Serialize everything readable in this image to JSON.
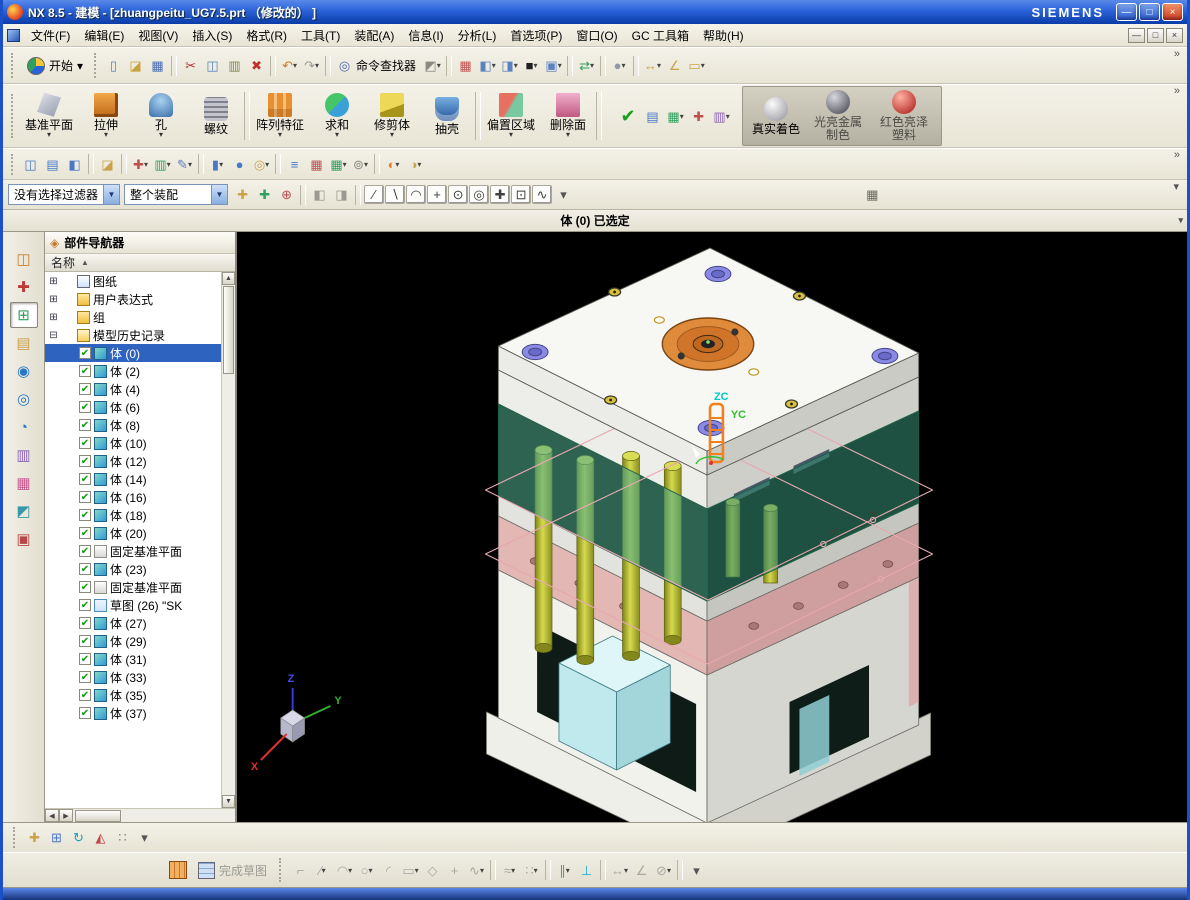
{
  "colors": {
    "titlebar": "#2a62d8",
    "selection": "#2f63c0",
    "viewport_bg": "#000000",
    "check_green": "#0c9a0c"
  },
  "chrome": {
    "overflow": "»",
    "more": "▾",
    "up": "▲",
    "down": "▼",
    "left": "◀",
    "right": "▶"
  },
  "window": {
    "title": "NX 8.5 - 建模 - [zhuangpeitu_UG7.5.prt （修改的） ]",
    "brand": "SIEMENS",
    "minimize": "—",
    "restore": "□",
    "close": "×"
  },
  "menu": {
    "items": [
      {
        "name": "menu-file",
        "label": "文件(F)"
      },
      {
        "name": "menu-edit",
        "label": "编辑(E)"
      },
      {
        "name": "menu-view",
        "label": "视图(V)"
      },
      {
        "name": "menu-insert",
        "label": "插入(S)"
      },
      {
        "name": "menu-format",
        "label": "格式(R)"
      },
      {
        "name": "menu-tools",
        "label": "工具(T)"
      },
      {
        "name": "menu-assemblies",
        "label": "装配(A)"
      },
      {
        "name": "menu-information",
        "label": "信息(I)"
      },
      {
        "name": "menu-analysis",
        "label": "分析(L)"
      },
      {
        "name": "menu-preferences",
        "label": "首选项(P)"
      },
      {
        "name": "menu-window",
        "label": "窗口(O)"
      },
      {
        "name": "menu-gc-toolbox",
        "label": "GC 工具箱"
      },
      {
        "name": "menu-help",
        "label": "帮助(H)"
      }
    ]
  },
  "toolbar1": {
    "start_label": "开始",
    "start_dd": "▾",
    "finder_label": "命令查找器",
    "icons_a": [
      {
        "name": "new-part-icon",
        "g": "▯",
        "c": "#5a82c0"
      },
      {
        "name": "open-icon",
        "g": "◪",
        "c": "#c8a23a"
      },
      {
        "name": "save-icon",
        "g": "▦",
        "c": "#4668b0"
      },
      {
        "cls": "sep",
        "inter": "false"
      },
      {
        "name": "cut-icon",
        "g": "✂",
        "c": "#b03030"
      },
      {
        "name": "copy-icon",
        "g": "◫",
        "c": "#5a82c0"
      },
      {
        "name": "paste-icon",
        "g": "▥",
        "c": "#7a8a50"
      },
      {
        "name": "delete-icon",
        "g": "✖",
        "c": "#c03030"
      },
      {
        "cls": "sep",
        "inter": "false"
      },
      {
        "name": "undo-icon",
        "g": "↶",
        "c": "#d07820",
        "dd": "▾"
      },
      {
        "name": "redo-icon",
        "g": "↷",
        "c": "#9a9a92",
        "dd": "▾"
      },
      {
        "cls": "sep",
        "inter": "false"
      },
      {
        "name": "command-finder-icon",
        "g": "◎",
        "c": "#4668b0"
      }
    ],
    "icons_b": [
      {
        "name": "touch-mode-icon",
        "g": "◩",
        "c": "#8a8a82",
        "dd": "▾"
      },
      {
        "cls": "sep",
        "inter": "false"
      },
      {
        "name": "window-grid-icon",
        "g": "▦",
        "c": "#c05050"
      },
      {
        "name": "cascade-windows-icon",
        "g": "◧",
        "c": "#5a82c0",
        "dd": "▾"
      },
      {
        "name": "display-cube-icon",
        "g": "◨",
        "c": "#5a82c0",
        "dd": "▾"
      },
      {
        "name": "black-screen-icon",
        "g": "■",
        "c": "#202020",
        "dd": "▾"
      },
      {
        "name": "tile-windows-icon",
        "g": "▣",
        "c": "#5a82c0",
        "dd": "▾"
      },
      {
        "cls": "sep",
        "inter": "false"
      },
      {
        "name": "swap-views-icon",
        "g": "⇄",
        "c": "#30a060",
        "dd": "▾"
      },
      {
        "cls": "sep",
        "inter": "false"
      },
      {
        "name": "material-sphere-icon",
        "g": "●",
        "c": "#9098a8",
        "dd": "▾"
      },
      {
        "cls": "sep",
        "inter": "false"
      },
      {
        "name": "measure-distance-icon",
        "g": "↔",
        "c": "#caa24a",
        "dd": "▾"
      },
      {
        "name": "measure-angle-icon",
        "g": "∠",
        "c": "#caa24a"
      },
      {
        "name": "ruler-icon",
        "g": "▭",
        "c": "#caa24a",
        "dd": "▾"
      }
    ]
  },
  "toolbar2": {
    "items": [
      {
        "name": "datum-plane-button",
        "label": "基准平面",
        "icon": "fi-datum",
        "dd": "▾"
      },
      {
        "name": "extrude-button",
        "label": "拉伸",
        "icon": "fi-extrude",
        "dd": "▾"
      },
      {
        "name": "hole-button",
        "label": "孔",
        "icon": "fi-hole",
        "dd": "▾"
      },
      {
        "name": "thread-button",
        "label": "螺纹",
        "icon": "fi-thread",
        "dd": ""
      },
      {
        "cls": "fsep",
        "inter": "false"
      },
      {
        "name": "pattern-feature-button",
        "label": "阵列特征",
        "icon": "fi-pattern",
        "dd": "▾"
      },
      {
        "name": "unite-button",
        "label": "求和",
        "icon": "fi-unite",
        "dd": "▾"
      },
      {
        "name": "trim-body-button",
        "label": "修剪体",
        "icon": "fi-trim",
        "dd": "▾"
      },
      {
        "name": "shell-button",
        "label": "抽壳",
        "icon": "fi-shell",
        "dd": ""
      },
      {
        "cls": "fsep",
        "inter": "false"
      },
      {
        "name": "offset-region-button",
        "label": "偏置区域",
        "icon": "fi-offset",
        "dd": "▾"
      },
      {
        "name": "delete-face-button",
        "label": "删除面",
        "icon": "fi-delface",
        "dd": "▾"
      },
      {
        "cls": "fsep",
        "inter": "false"
      }
    ],
    "check_cluster": [
      {
        "name": "approve-check-icon",
        "g": "✔",
        "c": "#18a018",
        "cls": "big"
      },
      {
        "name": "mini-table-icon",
        "g": "▤",
        "c": "#4a78c8"
      },
      {
        "name": "mini-grid-icon",
        "g": "▦",
        "c": "#30a060",
        "dd": "▾"
      },
      {
        "name": "mini-axis-icon",
        "g": "✚",
        "c": "#c05050"
      },
      {
        "name": "mini-sheet-icon",
        "g": "▥",
        "c": "#8a62b8",
        "dd": "▾"
      }
    ],
    "shading": [
      {
        "name": "true-shading-button",
        "label": "真实着色",
        "icon": "fi-sph-gray",
        "dd": ""
      },
      {
        "name": "shiny-metal-shading-button",
        "label": "光亮金属制色",
        "icon": "fi-sph-dark",
        "dd": "",
        "cls": "dim wrap"
      },
      {
        "name": "red-plastic-shading-button",
        "label": "红色亮泽塑料",
        "icon": "fi-sph-red",
        "dd": "",
        "cls": "dim wrap"
      }
    ]
  },
  "toolbar3": {
    "icons": [
      {
        "name": "edit-section-icon",
        "g": "◫",
        "c": "#4a78c8"
      },
      {
        "name": "layer-settings-icon",
        "g": "▤",
        "c": "#4a78c8"
      },
      {
        "name": "view-section-icon",
        "g": "◧",
        "c": "#4a78c8"
      },
      {
        "cls": "sep",
        "inter": "false"
      },
      {
        "name": "open-book-icon",
        "g": "◪",
        "c": "#caa24a"
      },
      {
        "cls": "sep",
        "inter": "false"
      },
      {
        "name": "pmi-icon",
        "g": "✚",
        "c": "#c05050",
        "dd": "▾"
      },
      {
        "name": "annotation-icon",
        "g": "▥",
        "c": "#30a060",
        "dd": "▾"
      },
      {
        "name": "sketch-curve-icon",
        "g": "✎",
        "c": "#6078b8",
        "dd": "▾"
      },
      {
        "cls": "sep",
        "inter": "false"
      },
      {
        "name": "cylinder-icon",
        "g": "▮",
        "c": "#4a78c8",
        "dd": "▾"
      },
      {
        "name": "sphere-icon",
        "g": "●",
        "c": "#4a78c8"
      },
      {
        "name": "torus-icon",
        "g": "◎",
        "c": "#caa24a",
        "dd": "▾"
      },
      {
        "cls": "sep",
        "inter": "false"
      },
      {
        "name": "list-view-icon",
        "g": "≡",
        "c": "#4a78c8"
      },
      {
        "name": "table-red-icon",
        "g": "▦",
        "c": "#c05050"
      },
      {
        "name": "table-green-icon",
        "g": "▦",
        "c": "#30a060",
        "dd": "▾"
      },
      {
        "name": "gear-icon",
        "g": "⊚",
        "c": "#888880",
        "dd": "▾"
      },
      {
        "cls": "sep",
        "inter": "false"
      },
      {
        "name": "pair-orange-icon",
        "g": "◐",
        "c": "#e08030",
        "dd": "▾"
      },
      {
        "name": "pair-yellow-icon",
        "g": "◑",
        "c": "#caa24a",
        "dd": "▾"
      }
    ]
  },
  "selbar": {
    "filter_value": "没有选择过滤器",
    "scope_value": "整个装配",
    "dd": "▼",
    "icons": [
      {
        "name": "select-all-icon",
        "g": "✚",
        "c": "#caa24a"
      },
      {
        "name": "select-highlight-icon",
        "g": "✚",
        "c": "#30a060"
      },
      {
        "name": "select-previous-icon",
        "g": "⊕",
        "c": "#c05050"
      },
      {
        "cls": "sep",
        "inter": "false"
      },
      {
        "name": "gray-cube-a-icon",
        "g": "◧",
        "c": "#9a9a92"
      },
      {
        "name": "gray-cube-b-icon",
        "g": "◨",
        "c": "#9a9a92"
      },
      {
        "cls": "sep",
        "inter": "false"
      },
      {
        "name": "snap-endpoint-icon",
        "g": "∕",
        "c": "#404040",
        "cls": "tog"
      },
      {
        "name": "snap-midpoint-icon",
        "g": "∖",
        "c": "#404040",
        "cls": "tog"
      },
      {
        "name": "snap-arc-icon",
        "g": "◠",
        "c": "#404040",
        "cls": "tog"
      },
      {
        "name": "snap-point-icon",
        "g": "+",
        "c": "#404040",
        "cls": "tog"
      },
      {
        "name": "snap-center-icon",
        "g": "⊙",
        "c": "#404040",
        "cls": "tog"
      },
      {
        "name": "snap-quadrant-icon",
        "g": "◎",
        "c": "#404040",
        "cls": "tog"
      },
      {
        "name": "snap-intersection-icon",
        "g": "✚",
        "c": "#404040",
        "cls": "tog"
      },
      {
        "name": "snap-face-icon",
        "g": "⊡",
        "c": "#404040",
        "cls": "tog"
      },
      {
        "name": "snap-curve-icon",
        "g": "∿",
        "c": "#404040",
        "cls": "tog"
      },
      {
        "name": "snap-options-arrow",
        "g": "▾",
        "c": "#555"
      }
    ],
    "grid_glyph": "▦"
  },
  "prompt": {
    "text": "体 (0) 已选定"
  },
  "resource": {
    "icons": [
      {
        "name": "assembly-navigator-icon",
        "g": "◫",
        "c": "#d08030"
      },
      {
        "name": "constraint-navigator-icon",
        "g": "✚",
        "c": "#c03838"
      },
      {
        "name": "part-navigator-icon",
        "g": "⊞",
        "c": "#2e9e5e",
        "cls": "active"
      },
      {
        "name": "reuse-library-icon",
        "g": "▤",
        "c": "#caa24a"
      },
      {
        "name": "hd3d-tool-icon",
        "g": "◉",
        "c": "#2878c8"
      },
      {
        "name": "web-browser-icon",
        "g": "◎",
        "c": "#2878c8"
      },
      {
        "name": "history-icon",
        "g": "◔",
        "c": "#2878c8"
      },
      {
        "name": "process-studio-icon",
        "g": "▥",
        "c": "#8a62b8"
      },
      {
        "name": "manufacturing-wizards-icon",
        "g": "▦",
        "c": "#c85890"
      },
      {
        "name": "roles-icon",
        "g": "◩",
        "c": "#3898a8"
      },
      {
        "name": "system-materials-icon",
        "g": "▣",
        "c": "#b84848"
      }
    ]
  },
  "navigator": {
    "title": "部件导航器",
    "column": "名称",
    "sort": "▲",
    "items": [
      {
        "name": "tree-item-drawing",
        "label": "图纸",
        "exp": "⊞",
        "chk": "",
        "icon": "i-draw",
        "cls": ""
      },
      {
        "name": "tree-item-user-expressions",
        "label": "用户表达式",
        "exp": "⊞",
        "chk": "",
        "icon": "i-folder",
        "cls": ""
      },
      {
        "name": "tree-item-group",
        "label": "组",
        "exp": "⊞",
        "chk": "",
        "icon": "i-folder",
        "cls": ""
      },
      {
        "name": "tree-item-model-history",
        "label": "模型历史记录",
        "exp": "⊟",
        "chk": "",
        "icon": "i-foldero",
        "cls": ""
      },
      {
        "name": "tree-item-body-0",
        "label": "体 (0)",
        "exp": "",
        "chk": "✔",
        "icon": "i-body",
        "cls": "child sel"
      },
      {
        "name": "tree-item-body-2",
        "label": "体 (2)",
        "exp": "",
        "chk": "✔",
        "icon": "i-body",
        "cls": "child"
      },
      {
        "name": "tree-item-body-4",
        "label": "体 (4)",
        "exp": "",
        "chk": "✔",
        "icon": "i-body",
        "cls": "child"
      },
      {
        "name": "tree-item-body-6",
        "label": "体 (6)",
        "exp": "",
        "chk": "✔",
        "icon": "i-body",
        "cls": "child"
      },
      {
        "name": "tree-item-body-8",
        "label": "体 (8)",
        "exp": "",
        "chk": "✔",
        "icon": "i-body",
        "cls": "child"
      },
      {
        "name": "tree-item-body-10",
        "label": "体 (10)",
        "exp": "",
        "chk": "✔",
        "icon": "i-body",
        "cls": "child"
      },
      {
        "name": "tree-item-body-12",
        "label": "体 (12)",
        "exp": "",
        "chk": "✔",
        "icon": "i-body",
        "cls": "child"
      },
      {
        "name": "tree-item-body-14",
        "label": "体 (14)",
        "exp": "",
        "chk": "✔",
        "icon": "i-body",
        "cls": "child"
      },
      {
        "name": "tree-item-body-16",
        "label": "体 (16)",
        "exp": "",
        "chk": "✔",
        "icon": "i-body",
        "cls": "child"
      },
      {
        "name": "tree-item-body-18",
        "label": "体 (18)",
        "exp": "",
        "chk": "✔",
        "icon": "i-body",
        "cls": "child"
      },
      {
        "name": "tree-item-body-20",
        "label": "体 (20)",
        "exp": "",
        "chk": "✔",
        "icon": "i-body",
        "cls": "child"
      },
      {
        "name": "tree-item-datum-plane-22",
        "label": "固定基准平面",
        "exp": "",
        "chk": "✔",
        "icon": "i-datum",
        "cls": "child"
      },
      {
        "name": "tree-item-body-23",
        "label": "体 (23)",
        "exp": "",
        "chk": "✔",
        "icon": "i-body",
        "cls": "child"
      },
      {
        "name": "tree-item-datum-plane-25",
        "label": "固定基准平面",
        "exp": "",
        "chk": "✔",
        "icon": "i-datum",
        "cls": "child"
      },
      {
        "name": "tree-item-sketch-26",
        "label": "草图 (26) \"SK",
        "exp": "",
        "chk": "✔",
        "icon": "i-sketch",
        "cls": "child"
      },
      {
        "name": "tree-item-body-27",
        "label": "体 (27)",
        "exp": "",
        "chk": "✔",
        "icon": "i-body",
        "cls": "child"
      },
      {
        "name": "tree-item-body-29",
        "label": "体 (29)",
        "exp": "",
        "chk": "✔",
        "icon": "i-body",
        "cls": "child"
      },
      {
        "name": "tree-item-body-31",
        "label": "体 (31)",
        "exp": "",
        "chk": "✔",
        "icon": "i-body",
        "cls": "child"
      },
      {
        "name": "tree-item-body-33",
        "label": "体 (33)",
        "exp": "",
        "chk": "✔",
        "icon": "i-body",
        "cls": "child"
      },
      {
        "name": "tree-item-body-35",
        "label": "体 (35)",
        "exp": "",
        "chk": "✔",
        "icon": "i-body",
        "cls": "child"
      },
      {
        "name": "tree-item-body-37",
        "label": "体 (37)",
        "exp": "",
        "chk": "✔",
        "icon": "i-body",
        "cls": "child"
      }
    ]
  },
  "viewport": {
    "zc": "ZC",
    "yc": "YC",
    "x": "X",
    "y": "Y",
    "z": "Z"
  },
  "rowA": {
    "icons": [
      {
        "name": "pan-view-icon",
        "g": "✚",
        "c": "#caa24a"
      },
      {
        "name": "fit-view-icon",
        "g": "⊞",
        "c": "#4a78c8"
      },
      {
        "name": "refresh-view-icon",
        "g": "↻",
        "c": "#18a0b0"
      },
      {
        "name": "orient-view-icon",
        "g": "◭",
        "c": "#c04848"
      },
      {
        "name": "dots-options-icon",
        "g": "∷",
        "c": "#808078"
      },
      {
        "name": "rowa-more-arrow",
        "g": "▾",
        "c": "#555"
      }
    ]
  },
  "rowB": {
    "finish_label": "完成草图",
    "icons": [
      {
        "name": "profile-icon",
        "g": "⌐",
        "c": "#a8a89e"
      },
      {
        "name": "line-icon",
        "g": "∕",
        "c": "#a8a89e",
        "dd": "▾"
      },
      {
        "name": "arc-icon",
        "g": "◠",
        "c": "#a8a89e",
        "dd": "▾"
      },
      {
        "name": "circle-icon",
        "g": "○",
        "c": "#a8a89e",
        "dd": "▾"
      },
      {
        "name": "fillet-icon",
        "g": "◜",
        "c": "#a8a89e"
      },
      {
        "name": "rectangle-icon",
        "g": "▭",
        "c": "#a8a89e",
        "dd": "▾"
      },
      {
        "name": "polygon-icon",
        "g": "◇",
        "c": "#a8a89e"
      },
      {
        "name": "point-icon",
        "g": "+",
        "c": "#a8a89e"
      },
      {
        "name": "spline-icon",
        "g": "∿",
        "c": "#a8a89e",
        "dd": "▾"
      },
      {
        "cls": "sep",
        "inter": "false"
      },
      {
        "name": "offset-curve-icon",
        "g": "≈",
        "c": "#a8a89e",
        "dd": "▾"
      },
      {
        "name": "pattern-curve-icon",
        "g": "∷",
        "c": "#a8a89e",
        "dd": "▾"
      },
      {
        "cls": "sep",
        "inter": "false"
      },
      {
        "name": "constraint-parallel-icon",
        "g": "∥",
        "c": "#18b0c8",
        "dd": "▾"
      },
      {
        "name": "constraint-perpendicular-icon",
        "g": "⊥",
        "c": "#18b0c8"
      },
      {
        "cls": "sep",
        "inter": "false"
      },
      {
        "name": "dimension-icon",
        "g": "↔",
        "c": "#a8a89e",
        "dd": "▾"
      },
      {
        "name": "constraints-icon",
        "g": "∠",
        "c": "#a8a89e"
      },
      {
        "name": "show-constraints-icon",
        "g": "⊘",
        "c": "#a8a89e",
        "dd": "▾"
      },
      {
        "cls": "sep",
        "inter": "false"
      },
      {
        "name": "rowb-more-arrow",
        "g": "▾",
        "c": "#555"
      }
    ]
  }
}
